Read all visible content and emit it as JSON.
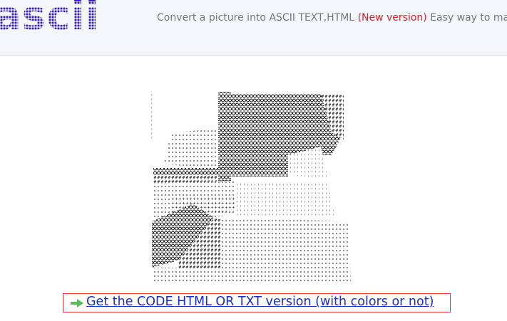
{
  "header": {
    "logo_text": "ascii",
    "tagline_before": "Convert a picture into ASCII TEXT,HTML ",
    "tagline_highlight": "(New version)",
    "tagline_after": " Easy way to make c"
  },
  "colors": {
    "logo": "#3a1fb5",
    "highlight": "#d2242a",
    "link": "#1a2fbf",
    "link_border": "#e03a3a",
    "arrow": "#5cb85c"
  },
  "download": {
    "icon": "arrow-right-icon",
    "label": "Get the CODE HTML OR TXT version (with colors or not)"
  }
}
